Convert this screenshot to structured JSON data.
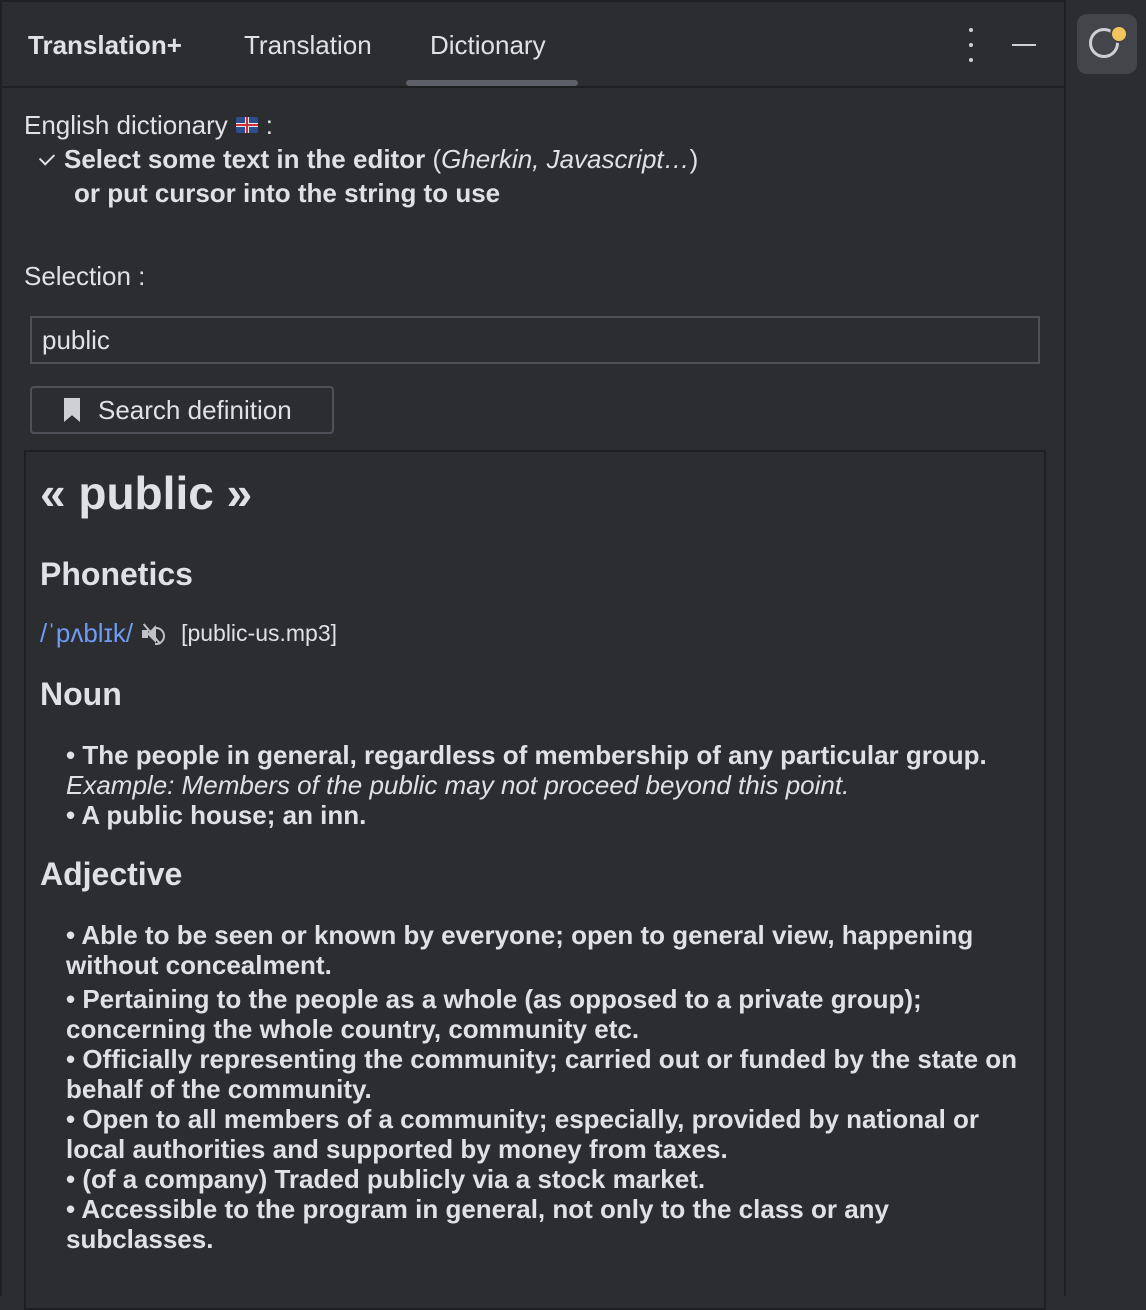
{
  "header": {
    "title": "Translation+",
    "tabs": [
      {
        "label": "Translation"
      },
      {
        "label": "Dictionary"
      }
    ]
  },
  "intro": {
    "label": "English dictionary",
    "colon": ":",
    "instruction_bold": "Select some text in the editor",
    "instruction_paren_open": " (",
    "instruction_examples": "Gherkin, Javascript…",
    "instruction_paren_close": ")",
    "instruction_line2": "or put cursor into the string to use"
  },
  "selection": {
    "label": "Selection :",
    "value": "public"
  },
  "search_button": {
    "label": "Search definition"
  },
  "result": {
    "word_heading": "« public »",
    "phonetics_heading": "Phonetics",
    "phonetic": "/ˈpʌblɪk/",
    "audio_file": "[public-us.mp3]",
    "noun_heading": "Noun",
    "noun_defs": [
      "• The people in general, regardless of membership of any particular group.",
      "• A public house; an inn."
    ],
    "noun_example": "Example: Members of the public may not proceed beyond this point.",
    "adjective_heading": "Adjective",
    "adjective_defs": [
      "• Able to be seen or known by everyone; open to general view, happening without concealment.",
      "• Pertaining to the people as a whole (as opposed to a private group); concerning the whole country, community etc.",
      "• Officially representing the community; carried out or funded by the state on behalf of the community.",
      "• Open to all members of a community; especially, provided by national or local authorities and supported by money from taxes.",
      "• (of a company) Traded publicly via a stock market.",
      "• Accessible to the program in general, not only to the class or any subclasses."
    ]
  },
  "icons": {
    "flag": "uk-flag-icon",
    "check": "check-icon",
    "bookmark": "bookmark-icon",
    "speaker": "speaker-icon",
    "more": "more-vertical-icon",
    "minimize": "minimize-icon",
    "rail": "notifications-icon"
  },
  "colors": {
    "background": "#2b2d30",
    "link": "#6f9bf4",
    "badge": "#f2c55c"
  }
}
